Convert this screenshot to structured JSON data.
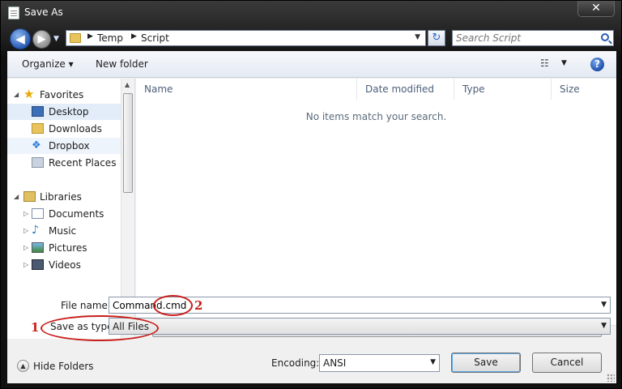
{
  "window": {
    "title": "Save As",
    "close": "✕"
  },
  "nav": {
    "breadcrumbs": [
      "Temp",
      "Script"
    ],
    "search_placeholder": "Search Script"
  },
  "toolbar": {
    "organize": "Organize ▾",
    "new_folder": "New folder"
  },
  "sidebar": {
    "favorites": {
      "label": "Favorites",
      "items": [
        "Desktop",
        "Downloads",
        "Dropbox",
        "Recent Places"
      ]
    },
    "libraries": {
      "label": "Libraries",
      "items": [
        "Documents",
        "Music",
        "Pictures",
        "Videos"
      ]
    }
  },
  "columns": [
    "Name",
    "Date modified",
    "Type",
    "Size"
  ],
  "empty_message": "No items match your search.",
  "form": {
    "file_name_label": "File name:",
    "file_name_value": "Command.cmd",
    "save_as_type_label": "Save as type:",
    "save_as_type_value": "All Files",
    "hide_folders": "Hide Folders",
    "encoding_label": "Encoding:",
    "encoding_value": "ANSI",
    "save": "Save",
    "cancel": "Cancel"
  },
  "annotations": [
    "1",
    "2"
  ],
  "colors": {
    "annotation": "#c8201c",
    "selection": "#e2edf9"
  }
}
